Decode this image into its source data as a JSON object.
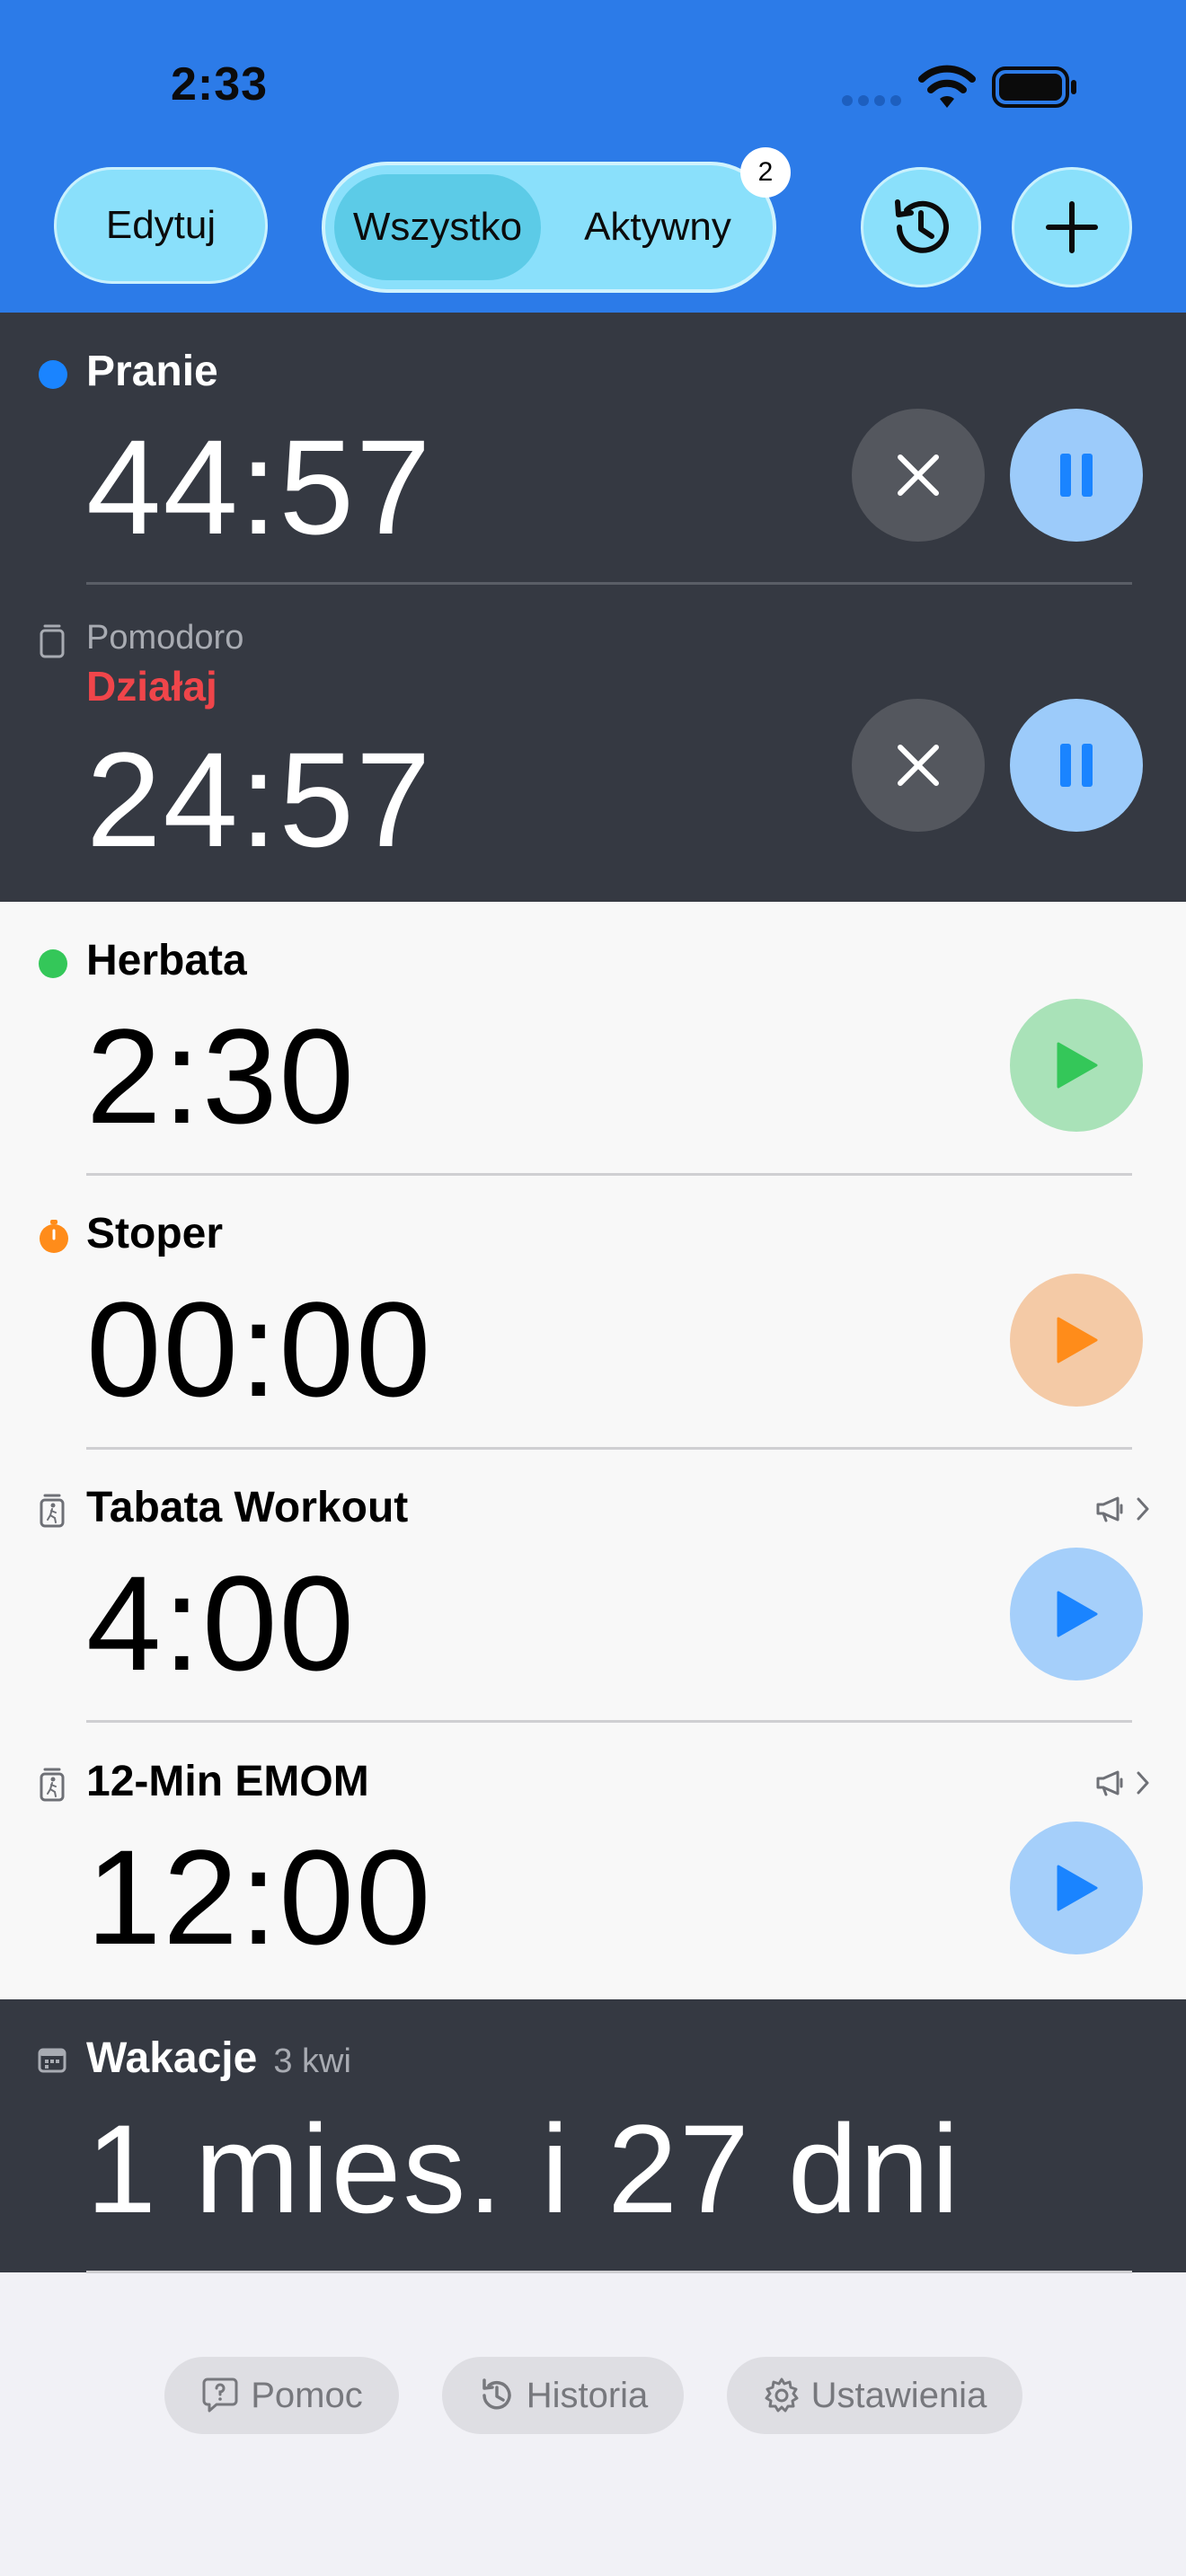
{
  "status_bar": {
    "time": "2:33"
  },
  "toolbar": {
    "edit_label": "Edytuj",
    "filter": {
      "all_label": "Wszystko",
      "active_label": "Aktywny",
      "active_badge": "2",
      "selected": "Wszystko"
    }
  },
  "timers": [
    {
      "title": "Pranie",
      "time": "44:57",
      "dot_color": "#1a84ff",
      "state": "running"
    },
    {
      "title": "Pomodoro",
      "phase": "Działaj",
      "time": "24:57",
      "state": "running"
    },
    {
      "title": "Herbata",
      "time": "2:30",
      "dot_color": "#34c759",
      "state": "stopped"
    },
    {
      "title": "Stoper",
      "time": "00:00",
      "icon": "stopwatch-icon",
      "state": "stopped"
    },
    {
      "title": "Tabata Workout",
      "time": "4:00",
      "icon": "workout-timer-icon",
      "state": "stopped"
    },
    {
      "title": "12-Min EMOM",
      "time": "12:00",
      "icon": "workout-timer-icon",
      "state": "stopped"
    }
  ],
  "countdown": {
    "title": "Wakacje",
    "date": "3 kwi",
    "remaining": "1 mies. i 27 dni"
  },
  "footer": {
    "help_label": "Pomoc",
    "history_label": "Historia",
    "settings_label": "Ustawienia"
  },
  "colors": {
    "header": "#2c7be8",
    "accent_blue": "#1a84ff",
    "green": "#34c759",
    "orange": "#ff8c1a",
    "red": "#f0454a",
    "dark_row": "#353942"
  }
}
